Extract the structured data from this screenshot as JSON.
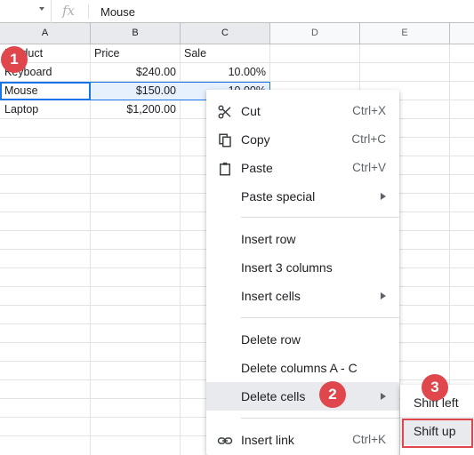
{
  "formula_bar": {
    "fx_symbol": "fx",
    "value": "Mouse"
  },
  "columns": [
    "A",
    "B",
    "C",
    "D",
    "E"
  ],
  "rows": [
    [
      "Product",
      "Price",
      "Sale"
    ],
    [
      "Keyboard",
      "$240.00",
      "10.00%"
    ],
    [
      "Mouse",
      "$150.00",
      "10.00%"
    ],
    [
      "Laptop",
      "$1,200.00",
      ""
    ]
  ],
  "context_menu": {
    "items": [
      {
        "label": "Cut",
        "shortcut": "Ctrl+X",
        "icon": "scissors-icon"
      },
      {
        "label": "Copy",
        "shortcut": "Ctrl+C",
        "icon": "copy-icon"
      },
      {
        "label": "Paste",
        "shortcut": "Ctrl+V",
        "icon": "clipboard-icon"
      },
      {
        "label": "Paste special",
        "submenu": true
      },
      {
        "label": "Insert row"
      },
      {
        "label": "Insert 3 columns"
      },
      {
        "label": "Insert cells",
        "submenu": true
      },
      {
        "label": "Delete row"
      },
      {
        "label": "Delete columns A - C"
      },
      {
        "label": "Delete cells",
        "submenu": true,
        "highlighted": true
      },
      {
        "label": "Insert link",
        "shortcut": "Ctrl+K",
        "icon": "link-icon"
      }
    ]
  },
  "submenu": {
    "items": [
      {
        "label": "Shift left"
      },
      {
        "label": "Shift up",
        "highlighted": true
      }
    ]
  },
  "callouts": [
    "1",
    "2",
    "3"
  ],
  "colors": {
    "selection_border": "#1a73e8",
    "selection_fill": "#e7f0fd",
    "callout_red": "#e0474c",
    "menu_highlight": "#e8eaed"
  }
}
